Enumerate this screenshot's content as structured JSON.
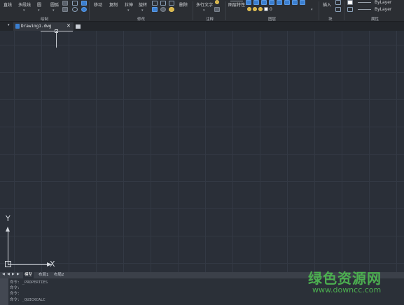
{
  "ribbon": {
    "buttons": {
      "line": "直线",
      "polyline": "多段线",
      "circle": "圆",
      "arc": "圆弧",
      "move": "移动",
      "copy": "复制",
      "stretch": "拉伸",
      "rotate": "旋转",
      "erase": "删除",
      "mtext": "多行文字",
      "layer_props": "图层特性",
      "insert": "插入"
    },
    "layer_value": "0",
    "property_values": [
      "ByLayer",
      "ByLayer"
    ],
    "groups": {
      "draw": "绘制",
      "modify": "修改",
      "annotation": "注释",
      "layer": "图层",
      "block": "块",
      "properties": "属性"
    }
  },
  "document": {
    "tab_name": "Drawing1.dwg",
    "close_glyph": "✕"
  },
  "canvas": {
    "x_axis_label": "X",
    "y_axis_label": "Y"
  },
  "layout_tabs": [
    "模型",
    "布局1",
    "布局2"
  ],
  "command_history": [
    "命令: _PROPERTIES",
    "命令:",
    "命令:",
    "命令: _QUICKCALC"
  ],
  "watermark": {
    "title": "绿色资源网",
    "url": "www.downcc.com"
  }
}
